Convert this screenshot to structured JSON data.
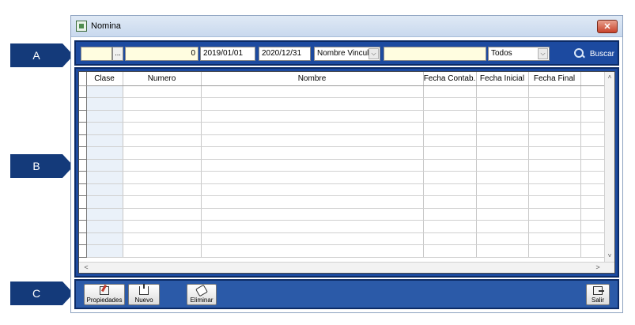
{
  "callouts": {
    "a": "A",
    "b": "B",
    "c": "C"
  },
  "window": {
    "title": "Nomina",
    "close_label": "✕"
  },
  "filters": {
    "code_value": "",
    "lookup_button": "...",
    "number_value": "0",
    "date_from": "2019/01/01",
    "date_to": "2020/12/31",
    "name_type_select": "Nombre Vincula",
    "text_filter": "",
    "status_select": "Todos",
    "dropdown_arrow": "⌵",
    "search_label": "Buscar"
  },
  "grid": {
    "columns": [
      "",
      "Clase",
      "Numero",
      "Nombre",
      "Fecha Contab.",
      "Fecha Inicial",
      "Fecha Final",
      ""
    ],
    "rows": 14,
    "scroll_up": "˄",
    "scroll_down": "˅",
    "scroll_left": "<",
    "scroll_right": ">"
  },
  "actions": {
    "properties": "Propiedades",
    "new": "Nuevo",
    "delete": "Eliminar",
    "exit": "Salir"
  },
  "colors": {
    "panel_blue": "#1c4aa0",
    "bottom_blue": "#2b5aa8",
    "callout_navy": "#143a7a",
    "field_yellow": "#fffde0"
  }
}
